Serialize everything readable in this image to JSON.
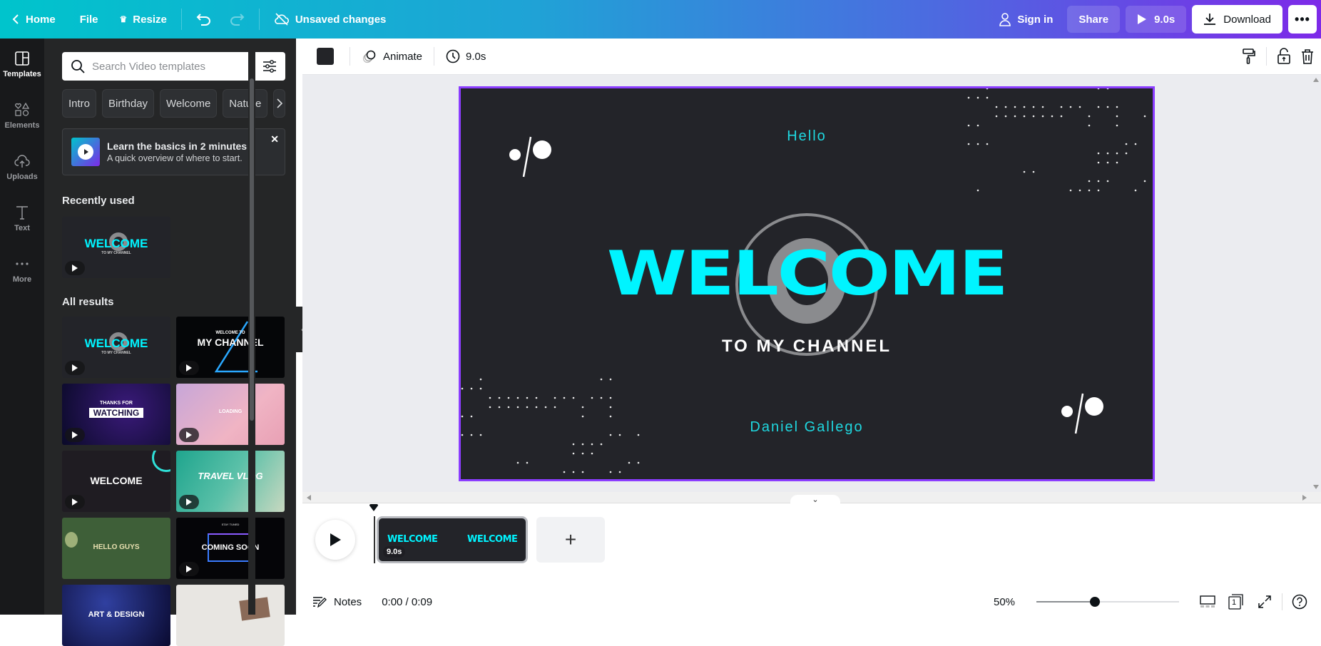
{
  "topbar": {
    "home": "Home",
    "file": "File",
    "resize": "Resize",
    "save_status": "Unsaved changes",
    "sign_in": "Sign in",
    "share": "Share",
    "play_duration": "9.0s",
    "download": "Download"
  },
  "rail": {
    "items": [
      {
        "label": "Templates",
        "icon": "templates-icon",
        "active": true
      },
      {
        "label": "Elements",
        "icon": "elements-icon"
      },
      {
        "label": "Uploads",
        "icon": "uploads-icon"
      },
      {
        "label": "Text",
        "icon": "text-icon"
      },
      {
        "label": "More",
        "icon": "more-icon"
      }
    ]
  },
  "panel": {
    "search_placeholder": "Search Video templates",
    "chips": [
      "Intro",
      "Birthday",
      "Welcome",
      "Nature"
    ],
    "promo": {
      "title": "Learn the basics in 2 minutes",
      "subtitle": "A quick overview of where to start."
    },
    "recently_used_title": "Recently used",
    "all_results_title": "All results",
    "recent_templates": [
      {
        "title": "WELCOME",
        "subtitle": "TO MY CHANNEL"
      }
    ],
    "results": [
      {
        "title": "WELCOME",
        "subtitle": "TO MY CHANNEL"
      },
      {
        "title": "MY CHANNEL",
        "subtitle": "WELCOME TO"
      },
      {
        "title": "WATCHING",
        "subtitle": "THANKS FOR"
      },
      {
        "title": "LOADING",
        "subtitle": ""
      },
      {
        "title": "WELCOME",
        "subtitle": ""
      },
      {
        "title": "TRAVEL VLOG",
        "subtitle": ""
      },
      {
        "title": "HELLO GUYS",
        "subtitle": ""
      },
      {
        "title": "COMING SOON",
        "subtitle": "STAY TUNED"
      },
      {
        "title": "ART & DESIGN",
        "subtitle": ""
      },
      {
        "title": "",
        "subtitle": ""
      }
    ]
  },
  "context_bar": {
    "animate": "Animate",
    "duration": "9.0s",
    "color": "#232428"
  },
  "canvas": {
    "hello": "Hello",
    "welcome": "WELCOME",
    "channel": "TO MY CHANNEL",
    "author": "Daniel Gallego",
    "background": "#232429",
    "accent": "#00f4ff"
  },
  "timeline": {
    "clip_duration": "9.0s",
    "clip_word": "WELCOME"
  },
  "footer": {
    "notes": "Notes",
    "timecode": "0:00 / 0:09",
    "zoom": "50%",
    "zoom_fraction": 0.41,
    "page_count": "1"
  }
}
